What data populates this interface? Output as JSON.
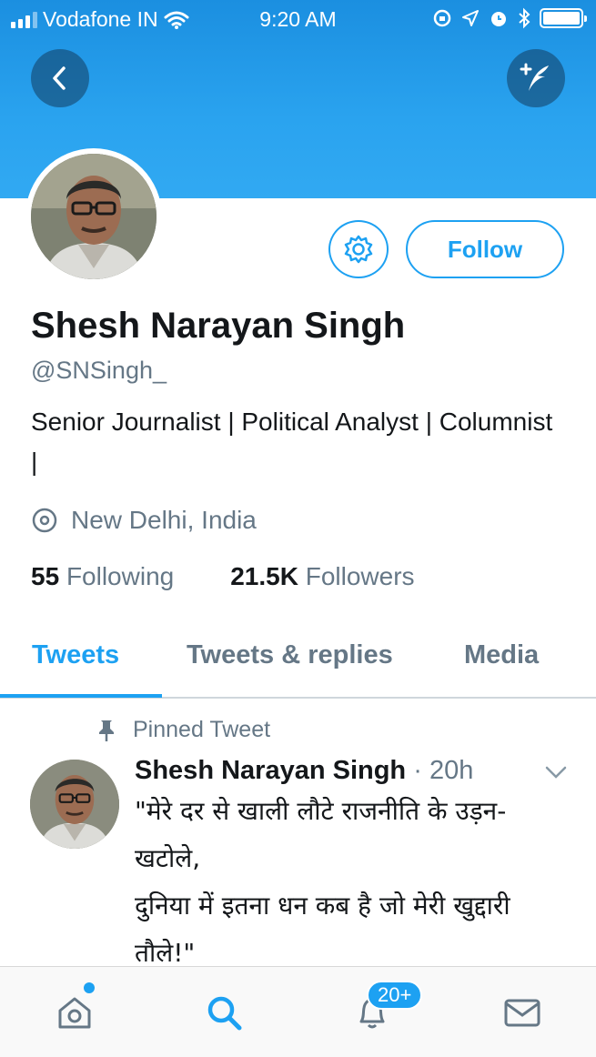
{
  "status_bar": {
    "carrier": "Vodafone IN",
    "time": "9:20 AM"
  },
  "profile": {
    "name": "Shesh Narayan Singh",
    "handle": "@SNSingh_",
    "bio": "Senior Journalist | Political Analyst | Columnist |",
    "location": "New Delhi, India",
    "following_count": "55",
    "following_label": "Following",
    "followers_count": "21.5K",
    "followers_label": "Followers",
    "follow_label": "Follow"
  },
  "tabs": [
    {
      "label": "Tweets",
      "active": true
    },
    {
      "label": "Tweets & replies",
      "active": false
    },
    {
      "label": "Media",
      "active": false
    }
  ],
  "pinned_tweet": {
    "pinned_label": "Pinned Tweet",
    "author": "Shesh Narayan Singh",
    "time": "20h",
    "text": "\"मेरे दर से खाली लौटे राजनीति के उड़न-\nखटोले,\nदुनिया में इतना धन कब है जो मेरी खुद्दारी\nतौले!\""
  },
  "bottom_bar": {
    "notifications_badge": "20+"
  },
  "colors": {
    "accent": "#1da1f2",
    "secondary_text": "#657786"
  }
}
